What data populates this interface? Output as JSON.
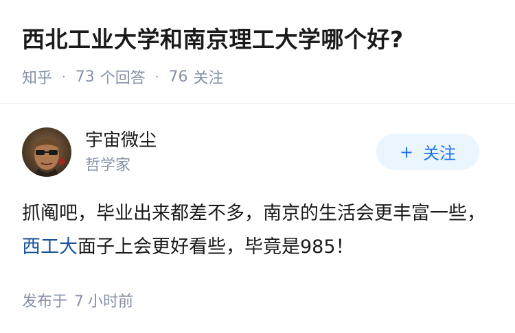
{
  "question": {
    "title": "西北工业大学和南京理工大学哪个好?",
    "source": "知乎",
    "separator": "·",
    "answer_count": "73",
    "answer_label": "个回答",
    "follow_count": "76",
    "follow_label": "关注"
  },
  "answer": {
    "author": {
      "name": "宇宙微尘",
      "headline": "哲学家",
      "avatar_icon": "user-avatar"
    },
    "follow_button": {
      "icon": "+",
      "label": "关注"
    },
    "content": {
      "line_part1": "抓阄吧，毕业出来都差不多，南京的生活会更丰富一些，",
      "link_text": "西工大",
      "line_part2": "面子上会更好看些，毕竟是985！"
    },
    "published": {
      "prefix": "发布于",
      "number": "7",
      "unit": "小时前"
    }
  },
  "colors": {
    "meta_gray": "#8590a6",
    "link_blue": "#175199",
    "follow_bg": "#ebf5fd",
    "follow_text": "#1772f6"
  }
}
